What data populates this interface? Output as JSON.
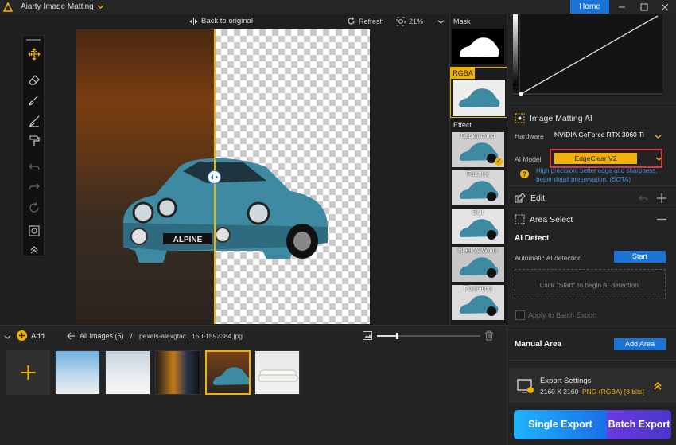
{
  "app": {
    "title": "Aiarty Image Matting",
    "home_label": "Home"
  },
  "canvas_bar": {
    "back_label": "Back to original",
    "refresh_label": "Refresh",
    "zoom": "21%"
  },
  "car_plate": "ALPINE",
  "effect_column": {
    "mask_label": "Mask",
    "rgba_label": "RGBA",
    "effect_label": "Effect",
    "effects": [
      {
        "label": "Background",
        "selected": true
      },
      {
        "label": "Feather",
        "selected": false
      },
      {
        "label": "Blur",
        "selected": false
      },
      {
        "label": "Black & White",
        "selected": false
      },
      {
        "label": "Pixelation",
        "selected": false
      }
    ]
  },
  "panel": {
    "matting_title": "Image Matting AI",
    "hardware_label": "Hardware",
    "hardware_value": "NVIDIA GeForce RTX 3060 Ti",
    "ai_model_label": "AI Model",
    "ai_model_value": "EdgeClear  V2",
    "ai_model_desc": "High precision, better edge and sharpness, better detail preservation. (SOTA)",
    "edit_title": "Edit",
    "area_select_title": "Area Select",
    "ai_detect_title": "AI Detect",
    "auto_detect_label": "Automatic AI detection",
    "start_label": "Start",
    "detect_hint": "Click \"Start\" to begin AI detection.",
    "apply_batch_label": "Apply to Batch Export",
    "manual_area_title": "Manual Area",
    "add_area_label": "Add Area",
    "export_title": "Export Settings",
    "export_size": "2160 X 2160",
    "export_format": "PNG (RGBA) [8 bits]",
    "single_export": "Single Export",
    "batch_export": "Batch Export"
  },
  "bottom": {
    "add_label": "Add",
    "all_images": "All Images (5)",
    "separator": "/",
    "current_file": "pexels-alexgtac...150-1592384.jpg",
    "zoom_level": 0.19
  },
  "colors": {
    "accent": "#f0b400",
    "primary_blue": "#1b74d3",
    "highlight_red": "#d93a3a"
  }
}
